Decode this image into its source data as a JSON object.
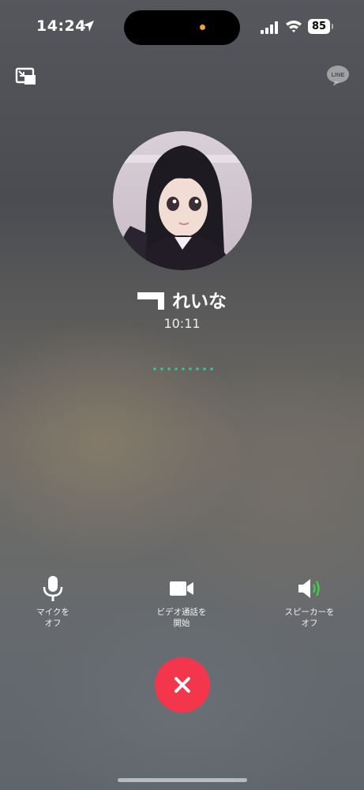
{
  "status_bar": {
    "time": "14:24",
    "battery": "85",
    "icons": [
      "location-arrow-icon",
      "cellular-signal-icon",
      "wifi-icon",
      "battery-icon"
    ]
  },
  "header": {
    "minimize_icon": "picture-in-picture-icon",
    "brand_icon": "line-logo-icon",
    "brand_text": "LINE"
  },
  "call": {
    "caller_name": "れいな",
    "duration": "10:11",
    "status": "connected",
    "avatar_icon": "profile-photo"
  },
  "controls": [
    {
      "label": "マイクを\nオフ",
      "icon": "microphone-icon"
    },
    {
      "label": "ビデオ通話を\n開始",
      "icon": "video-camera-icon"
    },
    {
      "label": "スピーカーを\nオフ",
      "icon": "speaker-on-icon"
    }
  ],
  "end_call": {
    "icon": "close-icon"
  },
  "colors": {
    "end_call": "#f4364c",
    "speaker_active": "#3ecf4a",
    "dots": "#3fbf9a",
    "island_dot": "#f5a623"
  }
}
